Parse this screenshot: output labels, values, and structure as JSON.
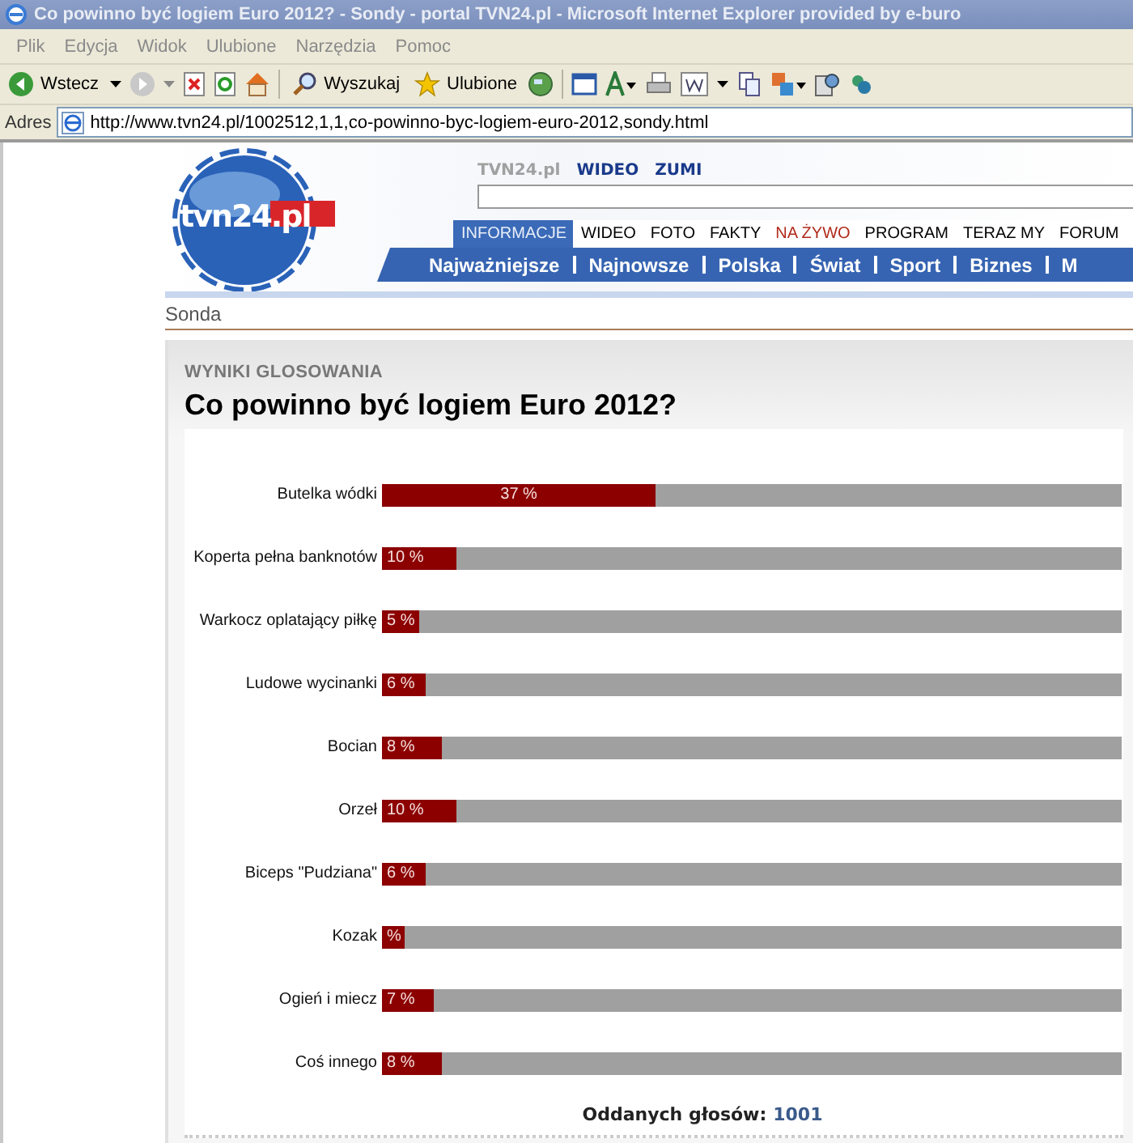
{
  "window": {
    "title": "Co powinno być logiem Euro 2012? - Sondy - portal TVN24.pl - Microsoft Internet Explorer provided by e-buro"
  },
  "menu": [
    "Plik",
    "Edycja",
    "Widok",
    "Ulubione",
    "Narzędzia",
    "Pomoc"
  ],
  "toolbar": {
    "back": "Wstecz",
    "search": "Wyszukaj",
    "favorites": "Ulubione"
  },
  "address": {
    "label": "Adres",
    "value": "http://www.tvn24.pl/1002512,1,1,co-powinno-byc-logiem-euro-2012,sondy.html"
  },
  "site": {
    "logo": "tvn24.pl",
    "top_links": [
      "TVN24.pl",
      "WIDEO",
      "ZUMI"
    ],
    "tabs": [
      {
        "label": "INFORMACJE",
        "selected": true
      },
      {
        "label": "WIDEO",
        "selected": false
      },
      {
        "label": "FOTO",
        "selected": false
      },
      {
        "label": "FAKTY",
        "selected": false
      },
      {
        "label": "NA ŻYWO",
        "selected": false,
        "kind": "live"
      },
      {
        "label": "PROGRAM",
        "selected": false
      },
      {
        "label": "TERAZ MY",
        "selected": false
      },
      {
        "label": "FORUM",
        "selected": false
      }
    ],
    "categories": [
      "Najważniejsze",
      "Najnowsze",
      "Polska",
      "Świat",
      "Sport",
      "Biznes",
      "M"
    ],
    "breadcrumb": "Sonda"
  },
  "poll": {
    "section_label": "WYNIKI GLOSOWANIA",
    "question": "Co powinno być logiem Euro 2012?",
    "options": [
      {
        "label": "Butelka wódki",
        "reading": "37 %",
        "level": 0.37
      },
      {
        "label": "Koperta pełna banknotów",
        "reading": "10 %",
        "level": 0.1
      },
      {
        "label": "Warkocz oplatający piłkę",
        "reading": "5 %",
        "level": 0.05
      },
      {
        "label": "Ludowe wycinanki",
        "reading": "6 %",
        "level": 0.06
      },
      {
        "label": "Bocian",
        "reading": "8 %",
        "level": 0.08
      },
      {
        "label": "Orzeł",
        "reading": "10 %",
        "level": 0.1
      },
      {
        "label": "Biceps \"Pudziana\"",
        "reading": "6 %",
        "level": 0.06
      },
      {
        "label": "Kozak",
        "reading": "%",
        "level": 0.03
      },
      {
        "label": "Ogień i miecz",
        "reading": "7 %",
        "level": 0.07
      },
      {
        "label": "Coś innego",
        "reading": "8 %",
        "level": 0.08
      }
    ],
    "total_label": "Oddanych głosów:",
    "total_value": "1001"
  }
}
